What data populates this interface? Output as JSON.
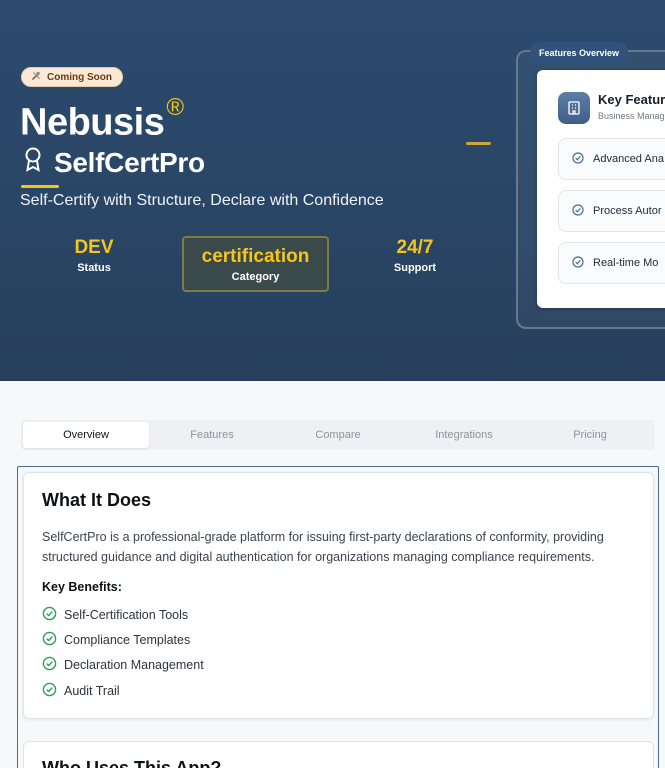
{
  "hero": {
    "badge": {
      "icon": "hammer-wrench-icon",
      "text": "Coming Soon"
    },
    "brand": "Nebusis",
    "brand_mark": "®",
    "product_icon": "award-ribbon-icon",
    "product_name": "SelfCertPro",
    "tagline": "Self-Certify with Structure, Declare with Confidence",
    "stats": [
      {
        "value": "DEV",
        "label": "Status"
      },
      {
        "value": "certification",
        "label": "Category"
      },
      {
        "value": "24/7",
        "label": "Support"
      }
    ]
  },
  "features_panel": {
    "label": "Features Overview",
    "title": "Key Feature",
    "subtitle": "Business Manag",
    "icon": "building-icon",
    "items": [
      {
        "icon": "check-circle-icon",
        "text": "Advanced Ana"
      },
      {
        "icon": "check-circle-icon",
        "text": "Process Autor"
      },
      {
        "icon": "check-circle-icon",
        "text": "Real-time Mo"
      }
    ]
  },
  "tabs": [
    "Overview",
    "Features",
    "Compare",
    "Integrations",
    "Pricing"
  ],
  "active_tab": "Overview",
  "what_it_does": {
    "title": "What It Does",
    "description": "SelfCertPro is a professional-grade platform for issuing first-party declarations of conformity, providing structured guidance and digital authentication for organizations managing compliance requirements.",
    "benefits_heading": "Key Benefits:",
    "benefits": [
      "Self-Certification Tools",
      "Compliance Templates",
      "Declaration Management",
      "Audit Trail"
    ]
  },
  "who_uses": {
    "title": "Who Uses This App?"
  },
  "colors": {
    "accent": "#f5c518",
    "hero_bg": "#2b4a6e",
    "check": "#2f9e5a"
  }
}
